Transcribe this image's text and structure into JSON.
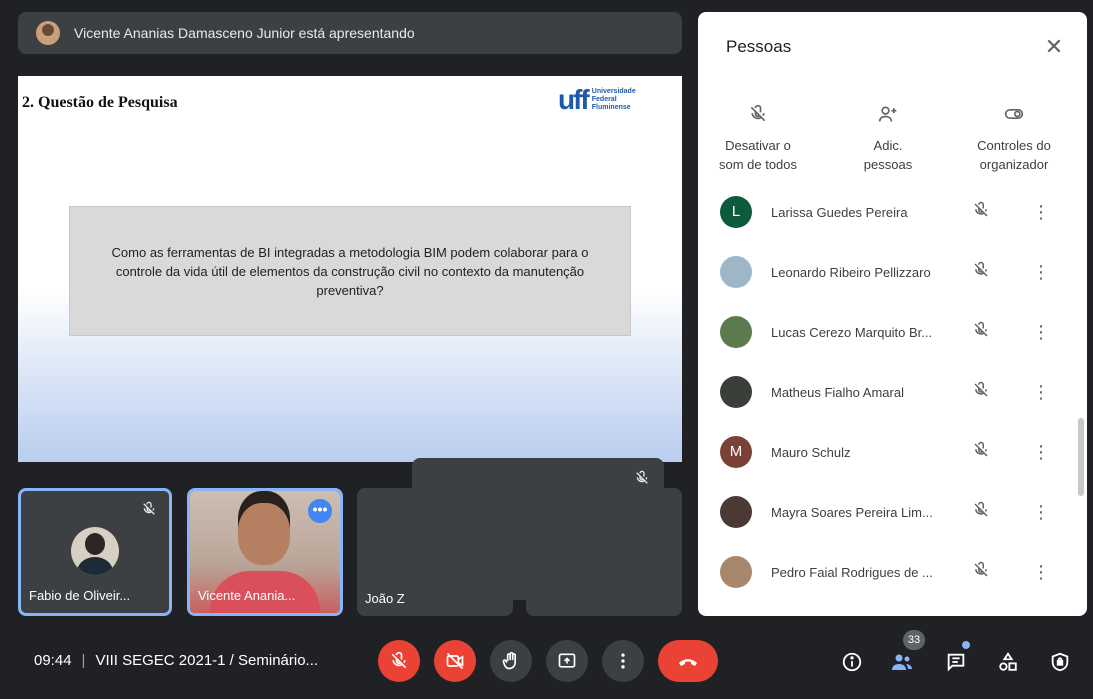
{
  "banner": {
    "text": "Vicente Ananias Damasceno Junior está apresentando"
  },
  "slide": {
    "title": "2. Questão de Pesquisa",
    "logo_mark": "uff",
    "logo_lines": [
      "Universidade",
      "Federal",
      "Fluminense"
    ],
    "question": "Como as ferramentas de BI integradas a metodologia BIM podem colaborar para o controle da vida útil de elementos da construção civil no contexto da manutenção preventiva?"
  },
  "tiles": [
    {
      "name": "Fabio de Oliveir...",
      "muted": true
    },
    {
      "name": "Vicente Anania...",
      "muted": false
    },
    {
      "name": "João Z"
    }
  ],
  "panel": {
    "title": "Pessoas",
    "actions": [
      {
        "label_1": "Desativar o",
        "label_2": "som de todos",
        "icon": "mic-off-icon"
      },
      {
        "label_1": "Adic.",
        "label_2": "pessoas",
        "icon": "person-add-icon"
      },
      {
        "label_1": "Controles do",
        "label_2": "organizador",
        "icon": "toggle-icon"
      }
    ],
    "people": [
      {
        "name": "Larissa Guedes Pereira",
        "initial": "L",
        "color": "#0b5b3c"
      },
      {
        "name": "Leonardo Ribeiro Pellizzaro",
        "initial": "",
        "color": "#9db7c9"
      },
      {
        "name": "Lucas Cerezo Marquito Br...",
        "initial": "",
        "color": "#5d7a4f"
      },
      {
        "name": "Matheus Fialho Amaral",
        "initial": "",
        "color": "#3b3f3a"
      },
      {
        "name": "Mauro Schulz",
        "initial": "M",
        "color": "#7a4236"
      },
      {
        "name": "Mayra Soares Pereira Lim...",
        "initial": "",
        "color": "#4a3a33"
      },
      {
        "name": "Pedro Faial Rodrigues de ...",
        "initial": "",
        "color": "#a8886c"
      }
    ]
  },
  "bottom": {
    "time": "09:44",
    "separator": "|",
    "meeting": "VIII SEGEC 2021-1 / Seminário...",
    "participant_count": "33"
  },
  "colors": {
    "accent": "#8ab4f8",
    "danger": "#ea4335",
    "bar": "#202124"
  }
}
